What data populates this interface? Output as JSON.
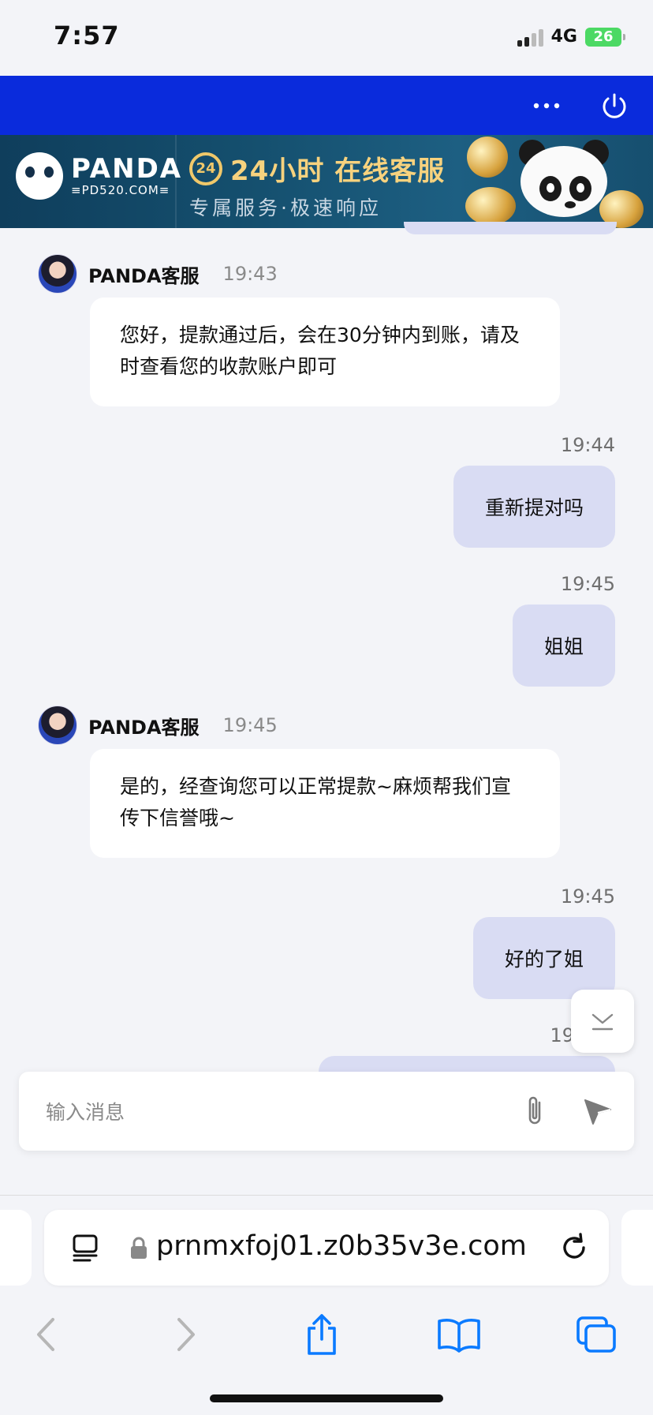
{
  "status_bar": {
    "time": "7:57",
    "network": "4G",
    "battery": "26"
  },
  "header": {
    "more_icon": "more-horizontal-icon",
    "power_icon": "power-icon",
    "background_color": "#0a2bdc"
  },
  "banner": {
    "brand": "PANDA",
    "domain": "≡PD520.COM≡",
    "badge": "24",
    "title": "24小时 在线客服",
    "subtitle": "专属服务·极速响应"
  },
  "messages": [
    {
      "type": "incoming",
      "sender": "PANDA客服",
      "time": "19:43",
      "text": "您好，提款通过后，会在30分钟内到账，请及时查看您的收款账户即可"
    },
    {
      "type": "outgoing",
      "time": "19:44",
      "text": "重新提对吗"
    },
    {
      "type": "outgoing",
      "time": "19:45",
      "text": "姐姐"
    },
    {
      "type": "incoming",
      "sender": "PANDA客服",
      "time": "19:45",
      "text": "是的，经查询您可以正常提款~麻烦帮我们宣传下信誉哦~"
    },
    {
      "type": "outgoing",
      "time": "19:45",
      "text": "好的了姐"
    },
    {
      "type": "outgoing",
      "time_partial": "19"
    }
  ],
  "input": {
    "placeholder": "输入消息",
    "attach_icon": "paperclip-icon",
    "send_icon": "send-icon"
  },
  "browser": {
    "url": "prnmxfoj01.z0b35v3e.com",
    "reader_icon": "reader-icon",
    "lock_icon": "lock-icon",
    "reload_icon": "reload-icon",
    "toolbar": [
      "back-icon",
      "forward-icon",
      "share-icon",
      "bookmarks-icon",
      "tabs-icon"
    ]
  },
  "colors": {
    "accent": "#0a2bdc",
    "outgoing_bubble": "#d9dcf3",
    "incoming_bubble": "#ffffff",
    "ios_blue": "#0a7aff"
  }
}
